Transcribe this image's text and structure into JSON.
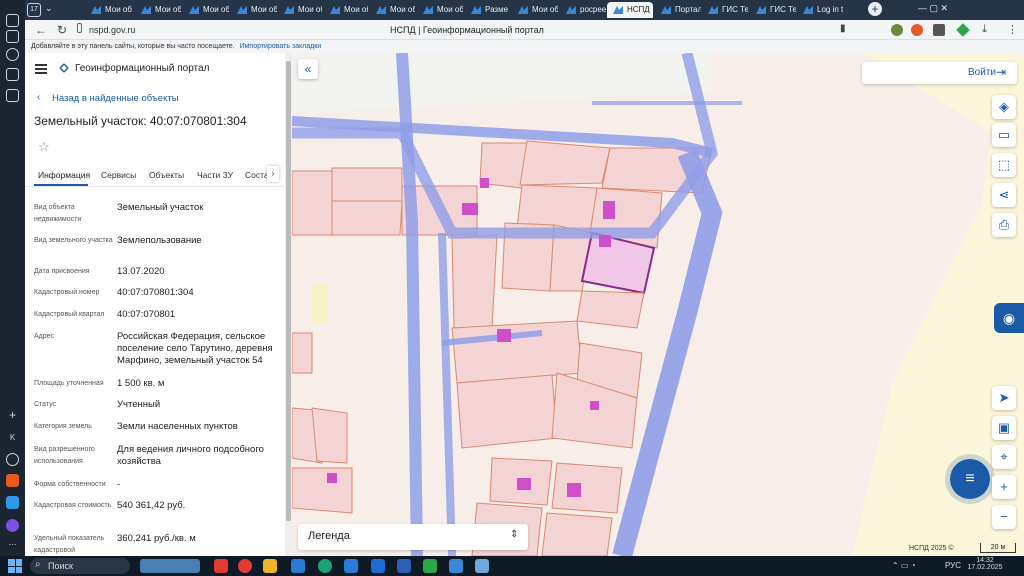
{
  "browser": {
    "tab_counter": "17",
    "tabs": [
      "Мои об",
      "Мои об",
      "Мои об",
      "Мои об",
      "Мои об",
      "Мои об",
      "Мои об",
      "Мои об",
      "Разме",
      "Мои об",
      "росрее",
      "НСПД",
      "Портал",
      "ГИС Те",
      "ГИС Те",
      "Log in t"
    ],
    "url": "nspd.gov.ru",
    "page_title": "НСПД | Геоинформационный портал",
    "bookmarks_text": "Добавляйте в эту панель сайты, которые вы часто посещаете.",
    "bookmarks_link": "Импортировать закладки"
  },
  "panel": {
    "portal_title": "Геоинформационный портал",
    "back_link": "Назад в найденные объекты",
    "object_title": "Земельный участок: 40:07:070801:304",
    "tabs": [
      "Информация",
      "Сервисы",
      "Объекты",
      "Части ЗУ",
      "Состав"
    ],
    "fields": [
      {
        "label": "Вид объекта недвижимости",
        "value": "Земельный участок"
      },
      {
        "label": "Вид земельного участка",
        "value": "Землепользование"
      },
      {
        "label": "Дата присвоения",
        "value": "13.07.2020"
      },
      {
        "label": "Кадастровый номер",
        "value": "40:07:070801:304"
      },
      {
        "label": "Кадастровый квартал",
        "value": "40:07:070801"
      },
      {
        "label": "Адрес",
        "value": "Российская Федерация, сельское поселение село Тарутино, деревня Марфино, земельный участок 54"
      },
      {
        "label": "Площадь уточненная",
        "value": "1 500 кв. м"
      },
      {
        "label": "Статус",
        "value": "Учтенный"
      },
      {
        "label": "Категория земель",
        "value": "Земли населенных пунктов"
      },
      {
        "label": "Вид разрешенного использования",
        "value": "Для ведения личного подсобного хозяйства"
      },
      {
        "label": "Форма собственности",
        "value": "-"
      },
      {
        "label": "Кадастровая стоимость",
        "value": "540 361,42 руб."
      },
      {
        "label": "Удельный показатель кадастровой",
        "value": "360,241 руб./кв. м"
      }
    ]
  },
  "map": {
    "login_label": "Войти",
    "legend_label": "Легенда",
    "footer_left": "НСПД 2025 ©",
    "scale_label": "20 м"
  },
  "taskbar": {
    "search_label": "Поиск",
    "lang": "РУС",
    "time": "14:32",
    "date": "17.02.2025"
  },
  "colors": {
    "accent": "#1a5aa6",
    "road": "#8f9de8",
    "parcel_fill": "#f3d3d3",
    "parcel_stroke": "#d9896f",
    "building": "#d04fc8",
    "selected": "#8a2a8a"
  }
}
